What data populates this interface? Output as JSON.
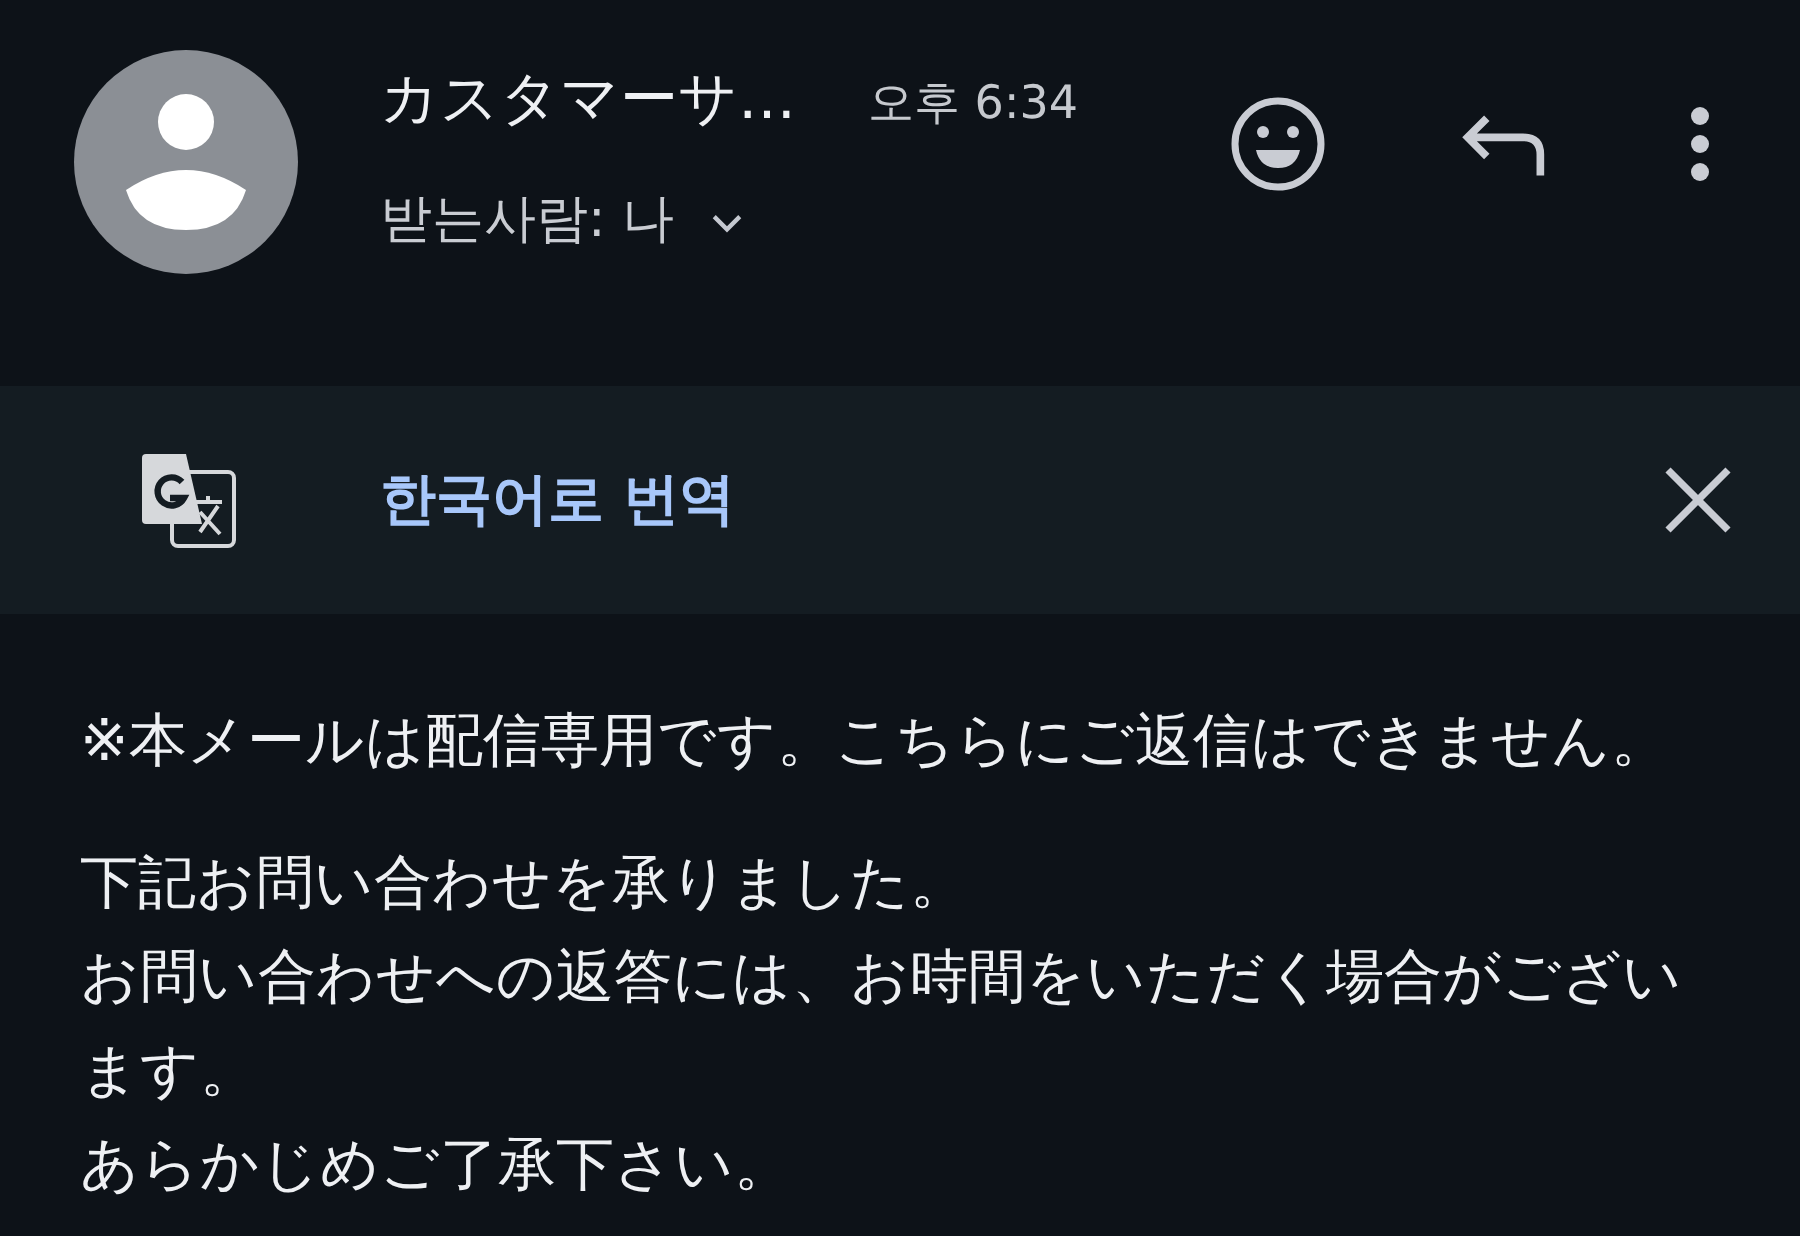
{
  "header": {
    "sender": "カスタマーサ…",
    "time": "오후 6:34",
    "recipient": "받는사람: 나",
    "details_expanded": false
  },
  "translate_bar": {
    "label": "한국어로 번역"
  },
  "body": {
    "paragraphs": [
      [
        "※本メールは配信専用です。こちらにご返信はできません。"
      ],
      [
        "下記お問い合わせを承りました。",
        "お問い合わせへの返答には、お時間をいただく場合がございます。",
        "あらかじめご了承下さい。"
      ]
    ]
  }
}
